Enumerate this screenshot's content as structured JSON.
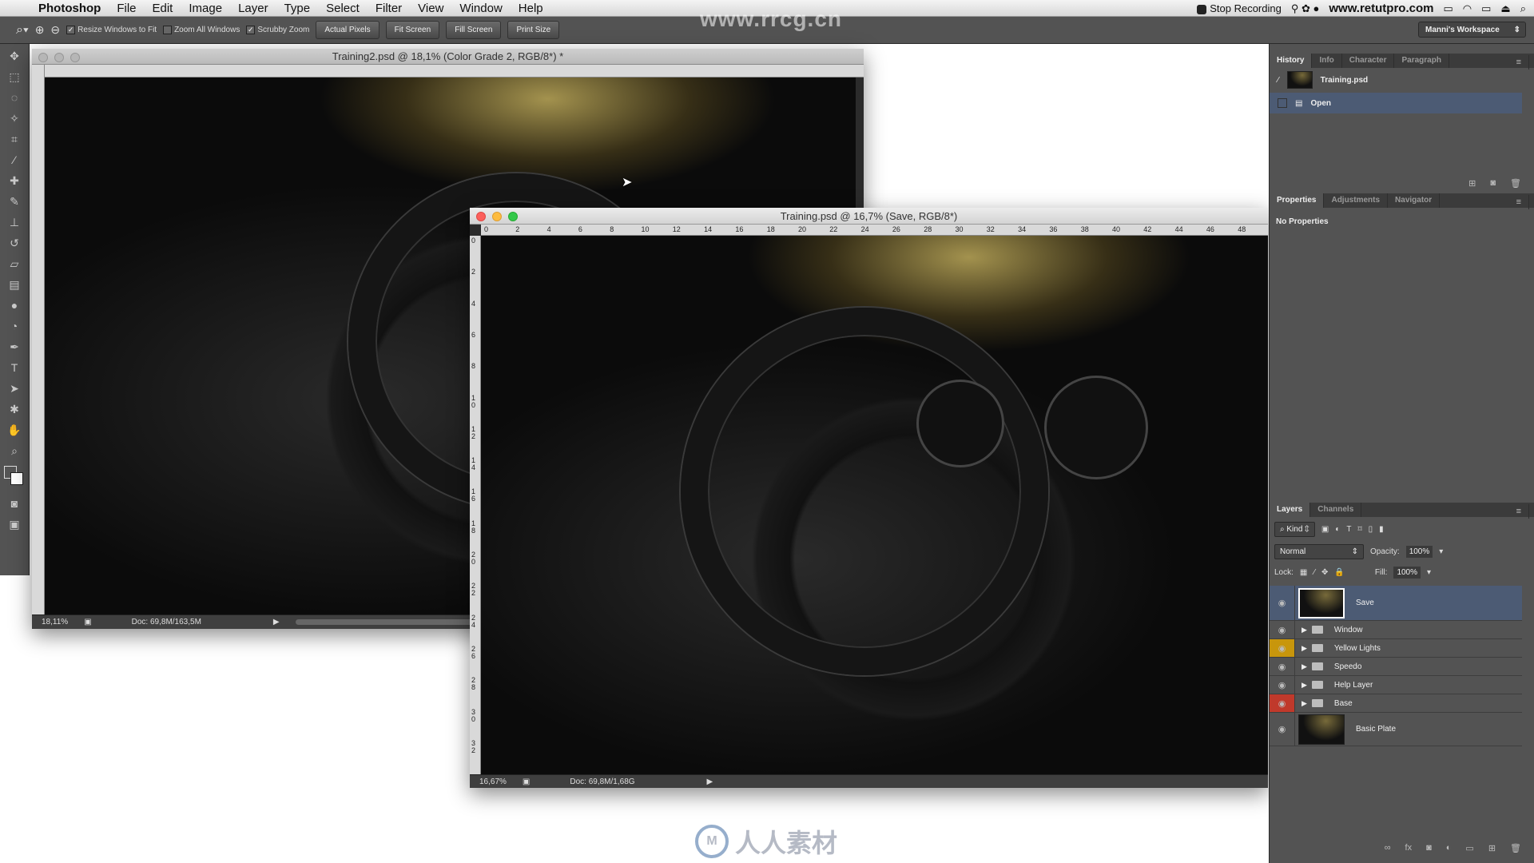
{
  "menubar": {
    "app": "Photoshop",
    "items": [
      "File",
      "Edit",
      "Image",
      "Layer",
      "Type",
      "Select",
      "Filter",
      "View",
      "Window",
      "Help"
    ],
    "recording": "Stop Recording",
    "url": "www.retutpro.com"
  },
  "options": {
    "resize_windows": "Resize Windows to Fit",
    "resize_checked": true,
    "zoom_all": "Zoom All Windows",
    "zoom_all_checked": false,
    "scrubby": "Scrubby Zoom",
    "scrubby_checked": true,
    "actual_pixels": "Actual Pixels",
    "fit_screen": "Fit Screen",
    "fill_screen": "Fill Screen",
    "print_size": "Print Size",
    "workspace": "Manni's Workspace"
  },
  "watermark_top": "www.rrcg.cn",
  "watermark_logo": "人人素材",
  "doc1": {
    "title": "Training2.psd @ 18,1% (Color Grade 2, RGB/8*) *",
    "zoom": "18,11%",
    "doc_size": "Doc: 69,8M/163,5M"
  },
  "doc2": {
    "title": "Training.psd @ 16,7% (Save, RGB/8*)",
    "zoom": "16,67%",
    "doc_size": "Doc: 69,8M/1,68G",
    "ruler_h": [
      "0",
      "2",
      "4",
      "6",
      "8",
      "10",
      "12",
      "14",
      "16",
      "18",
      "20",
      "22",
      "24",
      "26",
      "28",
      "30",
      "32",
      "34",
      "36",
      "38",
      "40",
      "42",
      "44",
      "46",
      "48"
    ],
    "ruler_v": [
      "0",
      "2",
      "4",
      "6",
      "8",
      "10",
      "12",
      "14",
      "16",
      "18",
      "20",
      "22",
      "24",
      "26",
      "28",
      "30",
      "32"
    ]
  },
  "history": {
    "tabs": [
      "History",
      "Info",
      "Character",
      "Paragraph"
    ],
    "snapshot": "Training.psd",
    "steps": [
      "Open"
    ]
  },
  "properties": {
    "tabs": [
      "Properties",
      "Adjustments",
      "Navigator"
    ],
    "empty": "No Properties"
  },
  "layers": {
    "tabs": [
      "Layers",
      "Channels"
    ],
    "filter": "Kind",
    "blend_mode": "Normal",
    "opacity_label": "Opacity:",
    "opacity": "100%",
    "lock_label": "Lock:",
    "fill_label": "Fill:",
    "fill": "100%",
    "items": [
      {
        "name": "Save",
        "type": "layer",
        "selected": true,
        "eye_color": ""
      },
      {
        "name": "Window",
        "type": "group",
        "eye_color": ""
      },
      {
        "name": "Yellow Lights",
        "type": "group",
        "eye_color": "#c8960c"
      },
      {
        "name": "Speedo",
        "type": "group",
        "eye_color": ""
      },
      {
        "name": "Help Layer",
        "type": "group",
        "eye_color": ""
      },
      {
        "name": "Base",
        "type": "group",
        "eye_color": "#c0392b"
      },
      {
        "name": "Basic Plate",
        "type": "layer",
        "eye_color": ""
      }
    ]
  }
}
